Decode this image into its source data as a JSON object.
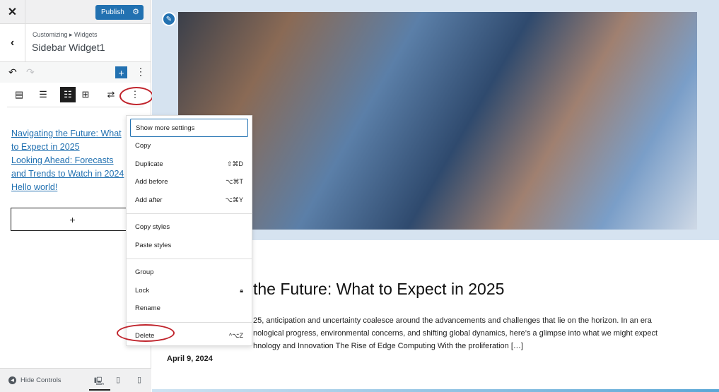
{
  "topbar": {
    "close_icon": "close-icon",
    "publish_label": "Publish",
    "settings_icon": "gear-icon"
  },
  "header": {
    "breadcrumb": "Customizing ▸ Widgets",
    "title": "Sidebar Widget1"
  },
  "toolbar": {
    "undo_icon": "undo-icon",
    "redo_icon": "redo-icon",
    "add_label": "+",
    "more_label": "⋮"
  },
  "block_toolbar": {
    "icons": [
      "latest-posts-icon",
      "align-icon",
      "list-view-icon",
      "grid-view-icon",
      "transform-icon",
      "more-options-icon"
    ],
    "more_label": "⋮"
  },
  "widget": {
    "links": [
      "Navigating the Future: What to Expect in 2025",
      "Looking Ahead: Forecasts and Trends to Watch in 2024",
      "Hello world!"
    ],
    "add_block_label": "+"
  },
  "footer": {
    "hide_controls": "Hide Controls",
    "devices": [
      "desktop-icon",
      "tablet-icon",
      "mobile-icon"
    ]
  },
  "menu": {
    "group1": [
      {
        "label": "Show more settings",
        "shortcut": ""
      },
      {
        "label": "Copy",
        "shortcut": ""
      },
      {
        "label": "Duplicate",
        "shortcut": "⇧⌘D"
      },
      {
        "label": "Add before",
        "shortcut": "⌥⌘T"
      },
      {
        "label": "Add after",
        "shortcut": "⌥⌘Y"
      }
    ],
    "group2": [
      {
        "label": "Copy styles"
      },
      {
        "label": "Paste styles"
      }
    ],
    "group3": [
      {
        "label": "Group"
      },
      {
        "label": "Lock",
        "icon": "lock-icon"
      },
      {
        "label": "Rename"
      }
    ],
    "group4": [
      {
        "label": "Delete",
        "shortcut": "^⌥Z"
      }
    ]
  },
  "preview": {
    "post_title": "the Future: What to Expect in 2025",
    "excerpt_lines": [
      "25, anticipation and uncertainty coalesce around the advancements and challenges that lie on the horizon. In an era",
      "nological progress, environmental concerns, and shifting global dynamics, here’s a glimpse into what we might expect",
      "hnology and Innovation The Rise of Edge Computing With the proliferation […]"
    ],
    "date": "April 9, 2024"
  },
  "colors": {
    "accent": "#2271b1",
    "highlight_oval": "#c0242c"
  }
}
